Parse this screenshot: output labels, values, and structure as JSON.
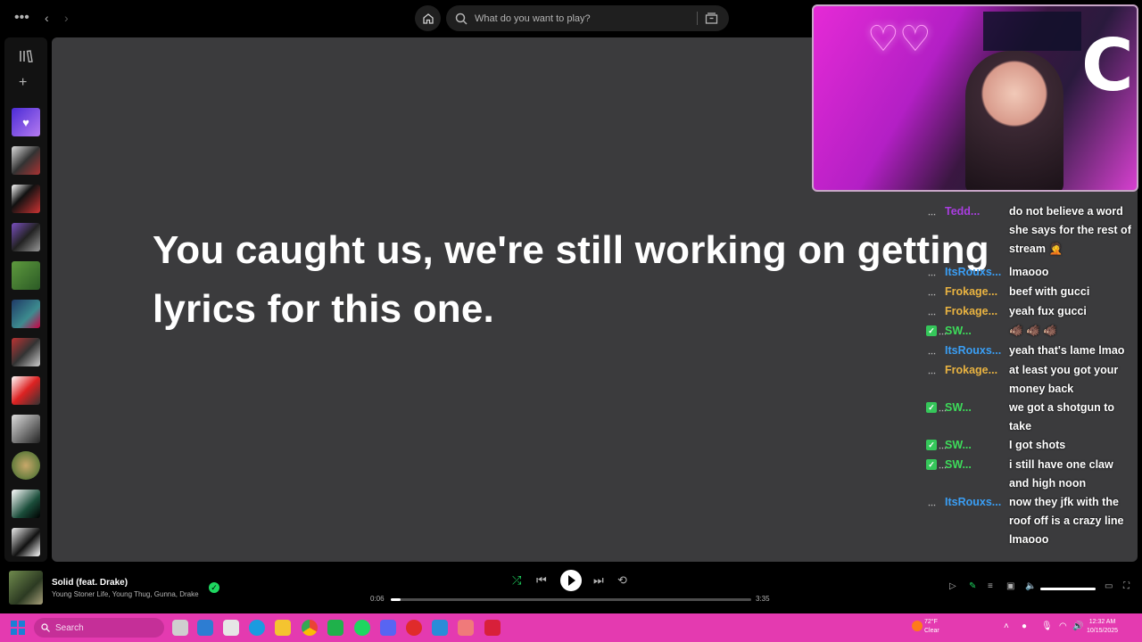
{
  "topbar": {
    "search_placeholder": "What do you want to play?",
    "menu_icon": "more-dots-icon",
    "back_icon": "chevron-left-icon",
    "forward_icon": "chevron-right-icon",
    "home_icon": "home-icon",
    "browse_icon": "browse-icon"
  },
  "sidebar": {
    "library_icon": "library-icon",
    "create_icon": "plus-icon",
    "liked_color": "#7b4af2"
  },
  "main": {
    "lyrics_message": "You caught us, we're still working on getting lyrics for this one."
  },
  "chat": {
    "messages": [
      {
        "user": "Tedd...",
        "text": "do not believe a word she says for the rest of stream 🤦",
        "color": "purple",
        "badges": "tw"
      },
      {
        "user": "ItsRouxs...",
        "text": "lmaooo",
        "color": "blue",
        "badges": "tw"
      },
      {
        "user": "Frokage...",
        "text": "beef with gucci",
        "color": "yellow",
        "badges": "tw"
      },
      {
        "user": "Frokage...",
        "text": "yeah fux gucci",
        "color": "yellow",
        "badges": "tw"
      },
      {
        "user": "SW...",
        "text": "🐗 🐗 🐗",
        "color": "green",
        "badges": "check"
      },
      {
        "user": "ItsRouxs...",
        "text": "yeah that's lame lmao",
        "color": "blue",
        "badges": "tw"
      },
      {
        "user": "Frokage...",
        "text": "at least you got your money back",
        "color": "yellow",
        "badges": "tw"
      },
      {
        "user": "SW...",
        "text": "we got a shotgun to take",
        "color": "green",
        "badges": "check"
      },
      {
        "user": "SW...",
        "text": "I got shots",
        "color": "green",
        "badges": "check"
      },
      {
        "user": "SW...",
        "text": "i still have one claw and high noon",
        "color": "green",
        "badges": "check"
      },
      {
        "user": "ItsRouxs...",
        "text": "now they jfk with the roof off is a crazy line lmaooo",
        "color": "blue",
        "badges": "tw"
      }
    ]
  },
  "player": {
    "track_title": "Solid (feat. Drake)",
    "track_artists": "Young Stoner Life, Young Thug, Gunna, Drake",
    "elapsed": "0:06",
    "duration": "3:35",
    "progress_fraction": 0.028,
    "volume_fraction": 1.0,
    "shuffle_active": true
  },
  "taskbar": {
    "search_label": "Search",
    "weather_temp": "72°F",
    "weather_desc": "Clear",
    "time": "12:32 AM",
    "date": "10/15/2025"
  }
}
